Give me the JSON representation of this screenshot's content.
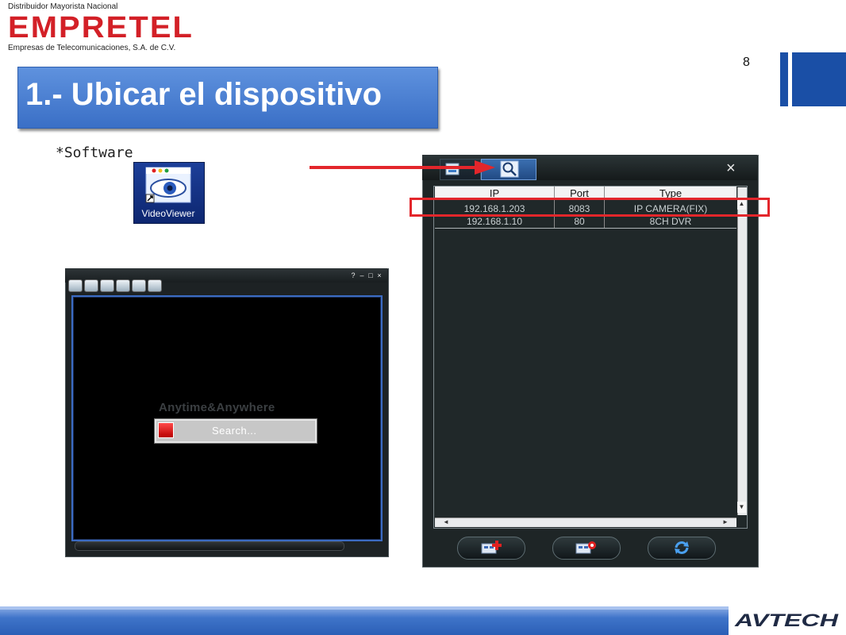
{
  "logo": {
    "top_text": "Distribuidor Mayorista Nacional",
    "brand": "EMPRETEL",
    "subtitle": "Empresas de Telecomunicaciones, S.A. de C.V.",
    "brand_color": "#d32027"
  },
  "page_number": "8",
  "title": "1.- Ubicar el dispositivo",
  "software_label": "*Software",
  "desktop_icon": {
    "label": "VideoViewer",
    "icon": "videoviewer-eye-icon"
  },
  "left_window": {
    "toolbar_icons": [
      "layout-icon",
      "folder-icon",
      "record-icon",
      "network-icon",
      "settings-icon",
      "info-icon"
    ],
    "controls": [
      "?",
      "–",
      "□",
      "×"
    ],
    "splash_text": "Anytime&Anywhere",
    "search_text": "Search..."
  },
  "right_window": {
    "tabs": [
      {
        "name": "device-list",
        "icon": "device-tree-icon"
      },
      {
        "name": "search",
        "icon": "magnifier-icon",
        "active": true
      }
    ],
    "close_label": "×",
    "table": {
      "headers": [
        "IP",
        "Port",
        "Type"
      ],
      "rows": [
        [
          "192.168.1.203",
          "8083",
          "IP CAMERA(FIX)"
        ],
        [
          "192.168.1.10",
          "80",
          "8CH DVR"
        ]
      ]
    },
    "scroll_arrows": {
      "up": "▲",
      "down": "▼",
      "left": "◄",
      "right": "►"
    },
    "buttons": [
      {
        "name": "add-device",
        "icon": "add-device-icon"
      },
      {
        "name": "device-settings",
        "icon": "device-gear-icon"
      },
      {
        "name": "refresh",
        "icon": "refresh-icon"
      }
    ]
  },
  "annotation": {
    "highlight_color": "#e3262b"
  },
  "footer": {
    "brand": "AVTECH"
  }
}
